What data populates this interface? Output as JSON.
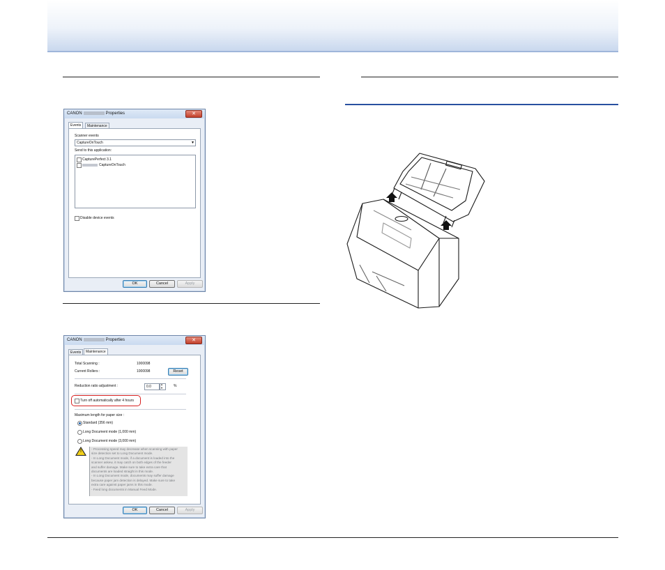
{
  "dialog1": {
    "title_prefix": "CANON",
    "title_suffix": "Properties",
    "close_glyph": "✕",
    "tabs": [
      "Events",
      "Maintenance"
    ],
    "scanner_events_label": "Scanner events",
    "scanner_events_value": "CaptureOnTouch",
    "dropdown_glyph": "▾",
    "send_to_label": "Send to this application:",
    "apps": [
      "CapturePerfect 3.1",
      "CaptureOnTouch"
    ],
    "disable_label": "Disable device events",
    "ok": "OK",
    "cancel": "Cancel",
    "apply": "Apply"
  },
  "dialog2": {
    "title_prefix": "CANON",
    "title_suffix": "Properties",
    "close_glyph": "✕",
    "tabs": [
      "Events",
      "Maintenance"
    ],
    "total_scanning_label": "Total Scanning :",
    "total_scanning_value": "1000098",
    "current_rollers_label": "Current Rollers :",
    "current_rollers_value": "1000098",
    "reset": "Reset",
    "reduction_label": "Reduction ratio adjustment :",
    "reduction_value": "0.0",
    "reduction_unit": "%",
    "spin_up": "▴",
    "spin_down": "▾",
    "turn_off_label": "Turn off automatically after 4 hours",
    "max_length_label": "Maximum length for paper size :",
    "options": [
      "Standard (356 mm)",
      "Long Document mode (1,000 mm)",
      "Long Document mode (3,000 mm)"
    ],
    "warning_glyph": "!",
    "warning_lines": [
      "- Processing speed may decrease when scanning with paper",
      "size detection set to Long Document mode.",
      "- In Long Document mode, if a document is loaded into the",
      "scanner askew, it may catch on both edges of the feeder",
      "and suffer damage. Make sure to take extra care that",
      "documents are loaded straight in this mode.",
      "- In Long Document mode, documents may suffer damage",
      "because paper jam detection is delayed. Make sure to take",
      "extra care against paper jams in this mode.",
      "- Feed long documents in Manual Feed Mode."
    ],
    "ok": "OK",
    "cancel": "Cancel",
    "apply": "Apply"
  },
  "colors": {
    "rule_blue": "#2850a0",
    "highlight_red": "#d62020"
  },
  "illustration": {
    "icon": "scanner-icon"
  }
}
